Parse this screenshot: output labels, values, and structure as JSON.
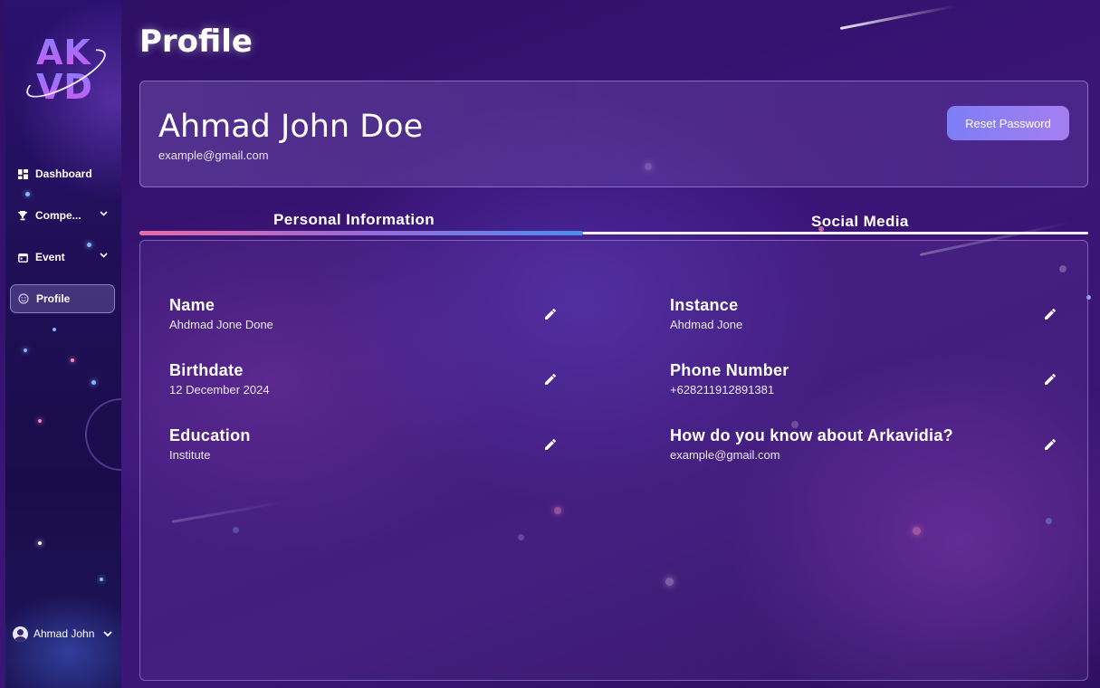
{
  "sidebar": {
    "logo_top": "AK",
    "logo_bottom": "VD",
    "items": [
      {
        "label": "Dashboard",
        "icon": "dashboard-icon"
      },
      {
        "label": "Compe...",
        "icon": "trophy-icon"
      },
      {
        "label": "Event",
        "icon": "calendar-icon"
      },
      {
        "label": "Profile",
        "icon": "smiley-icon",
        "active": true
      }
    ],
    "user": {
      "name": "Ahmad John",
      "icon": "user-avatar-icon"
    }
  },
  "page": {
    "title": "Profile"
  },
  "header": {
    "name": "Ahmad John Doe",
    "email": "example@gmail.com",
    "reset_label": "Reset Password"
  },
  "tabs": [
    {
      "label": "Personal Information",
      "active": true
    },
    {
      "label": "Social Media",
      "active": false
    }
  ],
  "fields": {
    "left": [
      {
        "label": "Name",
        "value": "Ahdmad Jone Done"
      },
      {
        "label": "Birthdate",
        "value": "12 December 2024"
      },
      {
        "label": "Education",
        "value": "Institute"
      }
    ],
    "right": [
      {
        "label": "Instance",
        "value": "Ahdmad Jone"
      },
      {
        "label": "Phone Number",
        "value": "+628211912891381"
      },
      {
        "label": "How do you know about Arkavidia?",
        "value": "example@gmail.com"
      }
    ]
  },
  "colors": {
    "accent_gradient_start": "#7e7df5",
    "accent_gradient_end": "#a47ff0",
    "tab_active_pink": "#e86aa6",
    "tab_active_blue": "#4c8cf0",
    "background": "#34126d"
  }
}
